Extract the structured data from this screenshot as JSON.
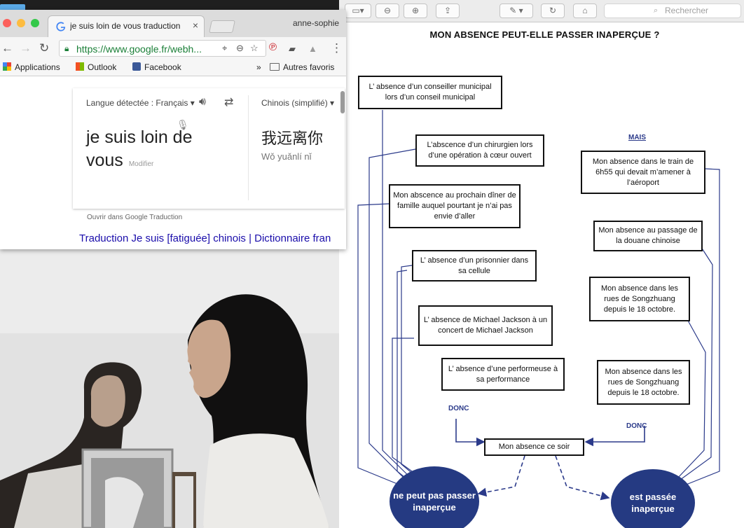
{
  "browser": {
    "tab_title": "je suis loin de vous traduction",
    "tab_close": "×",
    "profile": "anne-sophie",
    "url": "https://www.google.fr/webh...",
    "bookmarks": [
      {
        "label": "Applications",
        "icon": "apps-grid-icon"
      },
      {
        "label": "Outlook",
        "icon": "microsoft-logo-icon"
      },
      {
        "label": "Facebook",
        "icon": "facebook-icon"
      }
    ],
    "more_bookmarks": "»",
    "other_bookmarks": "Autres favoris",
    "translate": {
      "detected_language": "Langue détectée : Français ▾",
      "target_language": "Chinois (simplifié) ▾",
      "source_text": "je suis loin de vous",
      "edit_label": "Modifier",
      "translation": "我远离你",
      "pinyin": "Wǒ yuǎnlí nǐ",
      "open_link": "Ouvrir dans Google Traduction"
    },
    "result_link": "Traduction Je suis [fatiguée] chinois | Dictionnaire fran"
  },
  "viewer": {
    "search_placeholder": "Rechercher"
  },
  "document": {
    "title": "MON ABSENCE PEUT-ELLE PASSER INAPERÇUE ?",
    "left_boxes": [
      "L’ absence d’un conseiller municipal lors d’un conseil municipal",
      "L’abscence d’un chirurgien lors d’une opération à cœur ouvert",
      "Mon abscence au prochain dîner de famille auquel pourtant je n’ai pas envie d’aller",
      "L’ absence d’un prisonnier dans sa cellule",
      "L’ absence de Michael Jackson à un concert de Michael Jackson",
      "L’ absence d’une performeuse à sa performance"
    ],
    "right_boxes": [
      "Mon absence dans le train de 6h55 qui devait m’amener à l’aéroport",
      "Mon absence au passage de la douane chinoise",
      "Mon absence dans les rues de Songzhuang depuis le 18 octobre.",
      "Mon absence dans les rues de Songzhuang depuis le 18 octobre."
    ],
    "mais_label": "MAIS",
    "donc_left": "DONC",
    "donc_right": "DONC",
    "center_box": "Mon absence ce soir",
    "circle_left": "ne peut pas passer inaperçue",
    "circle_right": "est passée inaperçue",
    "ink_color": "#2b3a8a",
    "circle_color": "#253a82"
  }
}
